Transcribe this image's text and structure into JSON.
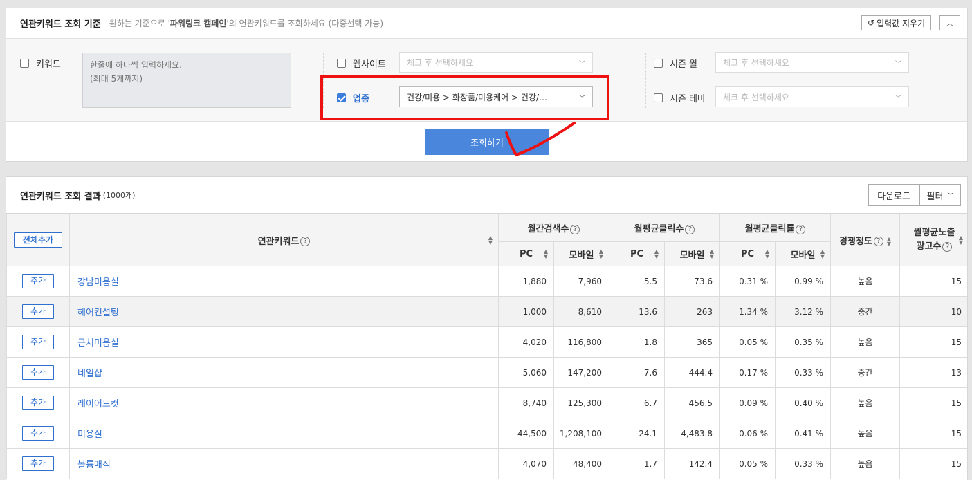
{
  "criteria": {
    "title": "연관키워드 조회 기준",
    "desc_pre": "원하는 기준으로 '",
    "desc_bold": "파워링크 캠페인",
    "desc_post": "'의 연관키워드를 조회하세요.(다중선택 가능)",
    "reset_label": "입력값 지우기",
    "keyword_label": "키워드",
    "keyword_placeholder_line1": "한줄에 하나씩 입력하세요.",
    "keyword_placeholder_line2": "(최대 5개까지)",
    "website_label": "웹사이트",
    "website_placeholder": "체크 후 선택하세요",
    "industry_label": "업종",
    "industry_value": "건강/미용 > 화장품/미용케어 > 건강/…",
    "season_month_label": "시즌 월",
    "season_month_placeholder": "체크 후 선택하세요",
    "season_theme_label": "시즌 테마",
    "season_theme_placeholder": "체크 후 선택하세요",
    "search_button": "조회하기"
  },
  "results": {
    "title": "연관키워드 조회 결과",
    "count": "(1000개)",
    "download_label": "다운로드",
    "filter_label": "필터",
    "add_all_label": "전체추가",
    "columns": {
      "keyword": "연관키워드",
      "monthly_search": "월간검색수",
      "avg_clicks": "월평균클릭수",
      "avg_ctr": "월평균클릭률",
      "competition": "경쟁정도",
      "ad_count_line1": "월평균노출",
      "ad_count_line2": "광고수",
      "pc": "PC",
      "mobile": "모바일"
    },
    "add_label": "추가",
    "rows": [
      {
        "keyword": "강남미용실",
        "search_pc": "1,880",
        "search_mobile": "7,960",
        "click_pc": "5.5",
        "click_mobile": "73.6",
        "ctr_pc": "0.31 %",
        "ctr_mobile": "0.99 %",
        "competition": "높음",
        "ads": "15"
      },
      {
        "keyword": "헤어컨설팅",
        "search_pc": "1,000",
        "search_mobile": "8,610",
        "click_pc": "13.6",
        "click_mobile": "263",
        "ctr_pc": "1.34 %",
        "ctr_mobile": "3.12 %",
        "competition": "중간",
        "ads": "10"
      },
      {
        "keyword": "근처미용실",
        "search_pc": "4,020",
        "search_mobile": "116,800",
        "click_pc": "1.8",
        "click_mobile": "365",
        "ctr_pc": "0.05 %",
        "ctr_mobile": "0.35 %",
        "competition": "높음",
        "ads": "15"
      },
      {
        "keyword": "네일샵",
        "search_pc": "5,060",
        "search_mobile": "147,200",
        "click_pc": "7.6",
        "click_mobile": "444.4",
        "ctr_pc": "0.17 %",
        "ctr_mobile": "0.33 %",
        "competition": "중간",
        "ads": "13"
      },
      {
        "keyword": "레이어드컷",
        "search_pc": "8,740",
        "search_mobile": "125,300",
        "click_pc": "6.7",
        "click_mobile": "456.5",
        "ctr_pc": "0.09 %",
        "ctr_mobile": "0.40 %",
        "competition": "높음",
        "ads": "15"
      },
      {
        "keyword": "미용실",
        "search_pc": "44,500",
        "search_mobile": "1,208,100",
        "click_pc": "24.1",
        "click_mobile": "4,483.8",
        "ctr_pc": "0.06 %",
        "ctr_mobile": "0.41 %",
        "competition": "높음",
        "ads": "15"
      },
      {
        "keyword": "볼륨매직",
        "search_pc": "4,070",
        "search_mobile": "48,400",
        "click_pc": "1.7",
        "click_mobile": "142.4",
        "ctr_pc": "0.05 %",
        "ctr_mobile": "0.33 %",
        "competition": "높음",
        "ads": "15"
      }
    ]
  },
  "colors": {
    "accent": "#4a87dc",
    "link": "#2e6fd0",
    "annotation": "#ee1111"
  }
}
